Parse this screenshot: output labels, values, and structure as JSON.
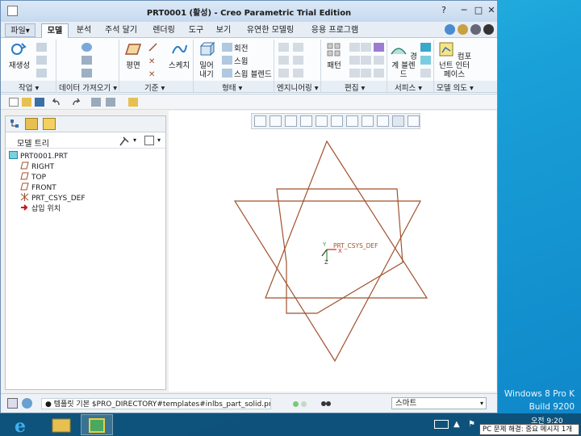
{
  "window": {
    "title": "PRT0001 (활성) - Creo Parametric Trial Edition"
  },
  "tabs": [
    {
      "label": "파일",
      "dropdown": "▾"
    },
    {
      "label": "모델"
    },
    {
      "label": "분석"
    },
    {
      "label": "주석 달기"
    },
    {
      "label": "렌더링"
    },
    {
      "label": "도구"
    },
    {
      "label": "보기"
    },
    {
      "label": "유연한 모델링"
    },
    {
      "label": "응용 프로그램"
    }
  ],
  "ribbon": {
    "reuse_label": "재생성",
    "plane_label": "평면",
    "sketch_label": "스케치",
    "extrude_label": "밀어내기",
    "revolve_label": "회전",
    "sweep_label": "스윕",
    "swept_blend_label": "스윕 블렌드",
    "pattern_label": "패턴",
    "boundary_blend_label": "경계 블렌드",
    "component_interface_label": "컴포넌트 인터페이스",
    "groups": [
      "작업",
      "데이터 가져오기",
      "기준",
      "형태",
      "엔지니어링",
      "편집",
      "서피스",
      "모델 의도"
    ]
  },
  "model_tree": {
    "header": "모델 트리",
    "items": [
      "PRT0001.PRT",
      "RIGHT",
      "TOP",
      "FRONT",
      "PRT_CSYS_DEF",
      "삽입 위치"
    ]
  },
  "graphics": {
    "csys_label": "PRT_CSYS_DEF",
    "axis_x": "X",
    "axis_y": "Y",
    "axis_z": "Z"
  },
  "status": {
    "message": "● 템플릿 기본 $PRO_DIRECTORY#templates#inlbs_part_solid.prt(을)를 템플릿으",
    "filter": "스마트"
  },
  "desktop": {
    "edition": "Windows 8 Pro K",
    "build": "Build 9200",
    "clock_time": "오전 9:20",
    "tooltip": "PC 문제 해결: 중요 메시지 1개"
  },
  "colors": {
    "datum_plane": "#a0522d",
    "csys_green": "#2a9d2a",
    "csys_red": "#cc2222",
    "insert_marker": "#cc1111",
    "accent": "#1aa0d8"
  }
}
